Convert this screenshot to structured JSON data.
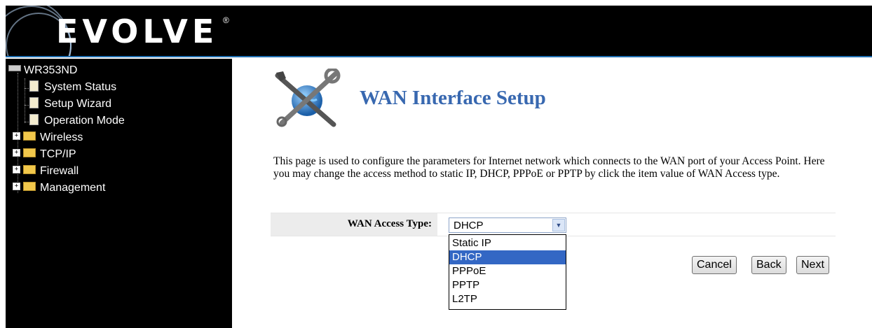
{
  "header": {
    "logo_text": "EVOLVE",
    "logo_mark": "®",
    "band_color": "#1f6fb2"
  },
  "sidebar": {
    "root_label": "WR353ND",
    "root_icon": "router-icon",
    "items": [
      {
        "label": "System Status",
        "icon": "page-icon"
      },
      {
        "label": "Setup Wizard",
        "icon": "page-icon"
      },
      {
        "label": "Operation Mode",
        "icon": "page-icon"
      },
      {
        "label": "Wireless",
        "icon": "folder-icon",
        "expander": "+"
      },
      {
        "label": "TCP/IP",
        "icon": "folder-icon",
        "expander": "+"
      },
      {
        "label": "Firewall",
        "icon": "folder-icon",
        "expander": "+"
      },
      {
        "label": "Management",
        "icon": "folder-icon",
        "expander": "+"
      }
    ]
  },
  "main": {
    "title": "WAN Interface Setup",
    "title_color": "#3868b0",
    "icon": "tools-globe-icon",
    "description": "This page is used to configure the parameters for Internet network which connects to the WAN port of your Access Point. Here you may change the access method to static IP, DHCP, PPPoE or PPTP by click the item value of WAN Access type.",
    "form": {
      "wan_access_label": "WAN Access Type:",
      "wan_access_value": "DHCP",
      "options": [
        "Static IP",
        "DHCP",
        "PPPoE",
        "PPTP",
        "L2TP"
      ],
      "selected_index": 1
    },
    "buttons": {
      "cancel": "Cancel",
      "back": "Back",
      "next": "Next"
    }
  }
}
